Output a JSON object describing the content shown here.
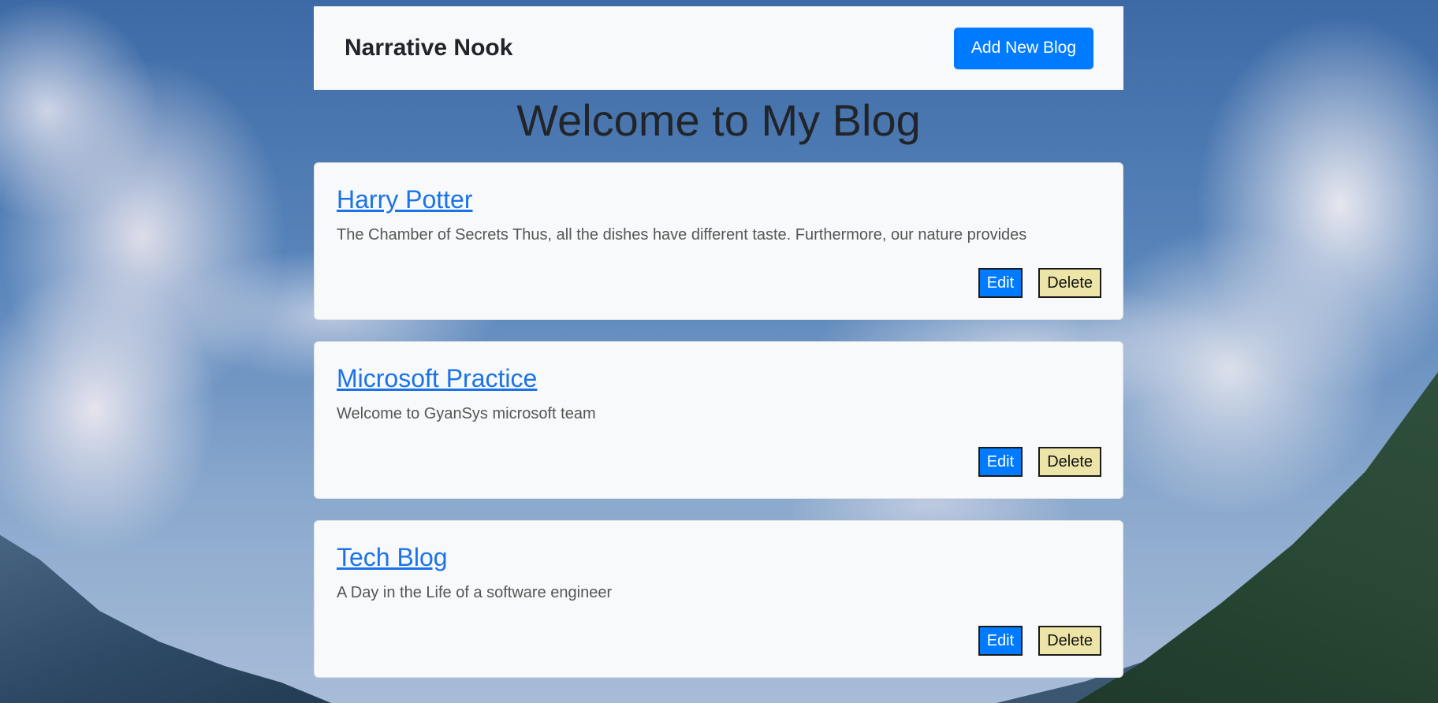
{
  "navbar": {
    "brand": "Narrative Nook",
    "add_button_label": "Add New Blog"
  },
  "main": {
    "heading": "Welcome to My Blog"
  },
  "blogs": [
    {
      "title": "Harry Potter",
      "excerpt": "The Chamber of Secrets Thus, all the dishes have different taste. Furthermore, our nature provides",
      "edit_label": "Edit",
      "delete_label": "Delete"
    },
    {
      "title": "Microsoft Practice",
      "excerpt": "Welcome to GyanSys microsoft team",
      "edit_label": "Edit",
      "delete_label": "Delete"
    },
    {
      "title": "Tech Blog",
      "excerpt": "A Day in the Life of a software engineer",
      "edit_label": "Edit",
      "delete_label": "Delete"
    }
  ],
  "colors": {
    "primary": "#007bff",
    "link": "#1a73e8",
    "delete_button": "#ede4a8",
    "card_bg": "#f8f9fa"
  },
  "background": "sky-clouds-mountains-image"
}
